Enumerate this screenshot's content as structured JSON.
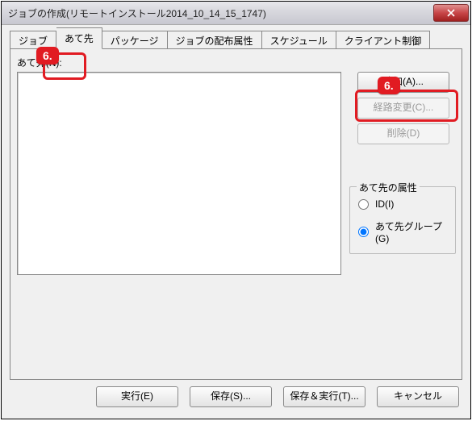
{
  "window": {
    "title": "ジョブの作成(リモートインストール2014_10_14_15_1747)"
  },
  "tabs": {
    "items": [
      {
        "label": "ジョブ"
      },
      {
        "label": "あて先"
      },
      {
        "label": "パッケージ"
      },
      {
        "label": "ジョブの配布属性"
      },
      {
        "label": "スケジュール"
      },
      {
        "label": "クライアント制御"
      }
    ]
  },
  "dest": {
    "label": "あて先(N):"
  },
  "side_buttons": {
    "add": "追加(A)...",
    "route": "経路変更(C)...",
    "delete": "削除(D)"
  },
  "group": {
    "title": "あて先の属性",
    "radio_id": "ID(I)",
    "radio_group": "あて先グループ(G)",
    "selected": "group"
  },
  "bottom": {
    "execute": "実行(E)",
    "save": "保存(S)...",
    "save_execute": "保存＆実行(T)...",
    "cancel": "キャンセル"
  },
  "callouts": {
    "c1": "6.",
    "c2": "6."
  }
}
